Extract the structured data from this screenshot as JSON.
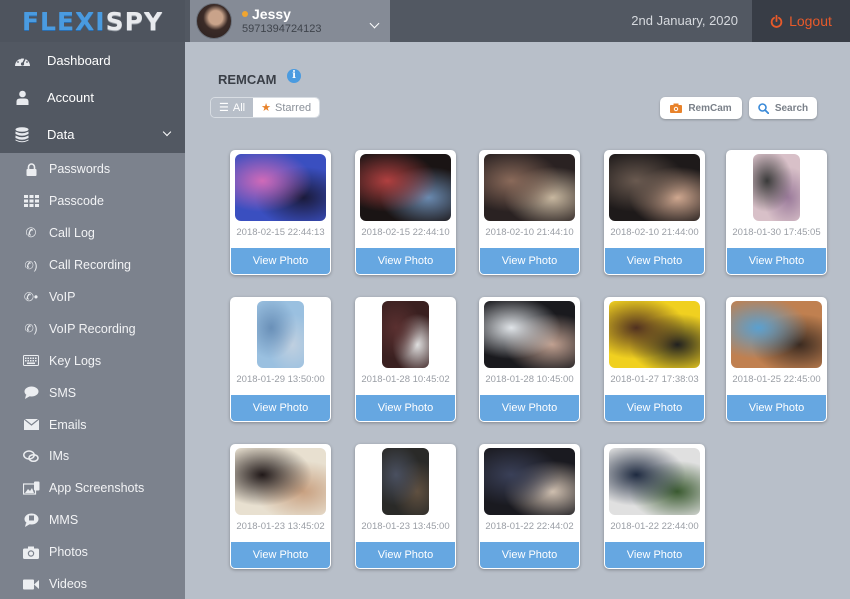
{
  "header": {
    "logo_part1": "FLEXI",
    "logo_part2": "SPY",
    "user": {
      "name": "Jessy",
      "id": "5971394724123",
      "status_color": "#f0a530"
    },
    "date": "2nd January, 2020",
    "logout_label": "Logout"
  },
  "sidebar": {
    "main_items": [
      {
        "label": "Dashboard",
        "icon": "dashboard-icon"
      },
      {
        "label": "Account",
        "icon": "user-icon"
      },
      {
        "label": "Data",
        "icon": "database-icon",
        "expanded": true
      }
    ],
    "sub_items": [
      {
        "label": "Passwords",
        "icon": "lock-icon"
      },
      {
        "label": "Passcode",
        "icon": "keypad-icon"
      },
      {
        "label": "Call Log",
        "icon": "phone-icon"
      },
      {
        "label": "Call Recording",
        "icon": "phone-recording-icon"
      },
      {
        "label": "VoIP",
        "icon": "voip-icon"
      },
      {
        "label": "VoIP Recording",
        "icon": "voip-recording-icon"
      },
      {
        "label": "Key Logs",
        "icon": "keyboard-icon"
      },
      {
        "label": "SMS",
        "icon": "chat-bubble-icon"
      },
      {
        "label": "Emails",
        "icon": "envelope-icon"
      },
      {
        "label": "IMs",
        "icon": "chat-bubbles-icon"
      },
      {
        "label": "App Screenshots",
        "icon": "screenshot-icon"
      },
      {
        "label": "MMS",
        "icon": "mms-icon"
      },
      {
        "label": "Photos",
        "icon": "camera-icon"
      },
      {
        "label": "Videos",
        "icon": "video-icon"
      }
    ]
  },
  "main": {
    "title": "REMCAM",
    "filters": {
      "all": "All",
      "starred": "Starred"
    },
    "buttons": {
      "remcam": "RemCam",
      "search": "Search"
    },
    "colors": {
      "accent": "#66a7e1",
      "logout": "#e85a2a",
      "star": "#e8822a"
    },
    "photos": [
      {
        "timestamp": "2018-02-15 22:44:13",
        "button": "View Photo",
        "orientation": "landscape",
        "palette": [
          "#3a4fc0",
          "#d06ab8",
          "#1a1a3a"
        ]
      },
      {
        "timestamp": "2018-02-15 22:44:10",
        "button": "View Photo",
        "orientation": "landscape",
        "palette": [
          "#1a1414",
          "#b04040",
          "#6a8ab0"
        ]
      },
      {
        "timestamp": "2018-02-10 21:44:10",
        "button": "View Photo",
        "orientation": "landscape",
        "palette": [
          "#2a2222",
          "#8a6a5a",
          "#c8b8a0"
        ]
      },
      {
        "timestamp": "2018-02-10 21:44:00",
        "button": "View Photo",
        "orientation": "landscape",
        "palette": [
          "#1e1a1a",
          "#6a5a50",
          "#d0a890"
        ]
      },
      {
        "timestamp": "2018-01-30 17:45:05",
        "button": "View Photo",
        "orientation": "portrait",
        "palette": [
          "#d8c0c8",
          "#3a3a3a",
          "#9a7a9a"
        ]
      },
      {
        "timestamp": "2018-01-29 13:50:00",
        "button": "View Photo",
        "orientation": "portrait",
        "palette": [
          "#9ac0e0",
          "#6a90b8",
          "#c0d0e0"
        ]
      },
      {
        "timestamp": "2018-01-28 10:45:02",
        "button": "View Photo",
        "orientation": "portrait",
        "palette": [
          "#3a2020",
          "#5a3030",
          "#e0e0e0"
        ]
      },
      {
        "timestamp": "2018-01-28 10:45:00",
        "button": "View Photo",
        "orientation": "landscape",
        "palette": [
          "#1a1a1e",
          "#e0e4e8",
          "#c0a090"
        ]
      },
      {
        "timestamp": "2018-01-27 17:38:03",
        "button": "View Photo",
        "orientation": "landscape",
        "palette": [
          "#f0d020",
          "#503020",
          "#202020"
        ]
      },
      {
        "timestamp": "2018-01-25 22:45:00",
        "button": "View Photo",
        "orientation": "landscape",
        "palette": [
          "#c08050",
          "#5aa0d0",
          "#3a2a20"
        ]
      },
      {
        "timestamp": "2018-01-23 13:45:02",
        "button": "View Photo",
        "orientation": "landscape",
        "palette": [
          "#e8e0d0",
          "#201818",
          "#c8a080"
        ]
      },
      {
        "timestamp": "2018-01-23 13:45:00",
        "button": "View Photo",
        "orientation": "portrait",
        "palette": [
          "#2a2a28",
          "#4a5060",
          "#605040"
        ]
      },
      {
        "timestamp": "2018-01-22 22:44:02",
        "button": "View Photo",
        "orientation": "landscape",
        "palette": [
          "#1a1a20",
          "#3a4058",
          "#d0c0b0"
        ]
      },
      {
        "timestamp": "2018-01-22 22:44:00",
        "button": "View Photo",
        "orientation": "landscape",
        "palette": [
          "#e0e0e0",
          "#1e2a40",
          "#3a5a30"
        ]
      }
    ]
  }
}
